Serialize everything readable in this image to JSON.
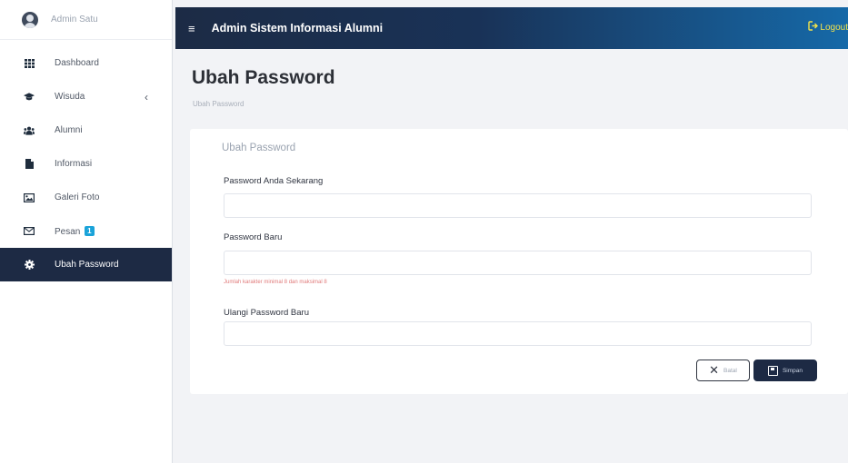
{
  "sidebar": {
    "profile_name": "Admin Satu",
    "items": [
      {
        "label": "Dashboard",
        "icon": "th-grid-icon"
      },
      {
        "label": "Wisuda",
        "icon": "graduation-cap-icon",
        "chevron": "‹"
      },
      {
        "label": "Alumni",
        "icon": "users-icon"
      },
      {
        "label": "Informasi",
        "icon": "file-icon"
      },
      {
        "label": "Galeri Foto",
        "icon": "image-icon"
      },
      {
        "label": "Pesan",
        "icon": "envelope-icon",
        "badge": "1"
      },
      {
        "label": "Ubah Password",
        "icon": "gear-icon",
        "active": true
      }
    ]
  },
  "topbar": {
    "menu_icon": "≡",
    "title": "Admin Sistem Informasi Alumni",
    "logout_label": "Logout",
    "gradient_start": "#1c2b45",
    "gradient_end": "#1669a8",
    "logout_color": "#f3e34a"
  },
  "page": {
    "title": "Ubah Password",
    "breadcrumb": "Ubah Password"
  },
  "form": {
    "card_title": "Ubah Password",
    "current_label": "Password Anda Sekarang",
    "current_value": "",
    "new_label": "Password Baru",
    "new_value": "",
    "new_hint": "Jumlah karakter minimal 8 dan maksimal 8",
    "confirm_label": "Ulangi Password Baru",
    "confirm_value": "",
    "reset_label": "Batal",
    "save_label": "Simpan"
  },
  "colors": {
    "sidebar_active": "#1d2a44",
    "accent": "#1aa3d9",
    "hint": "#e07a7a"
  }
}
